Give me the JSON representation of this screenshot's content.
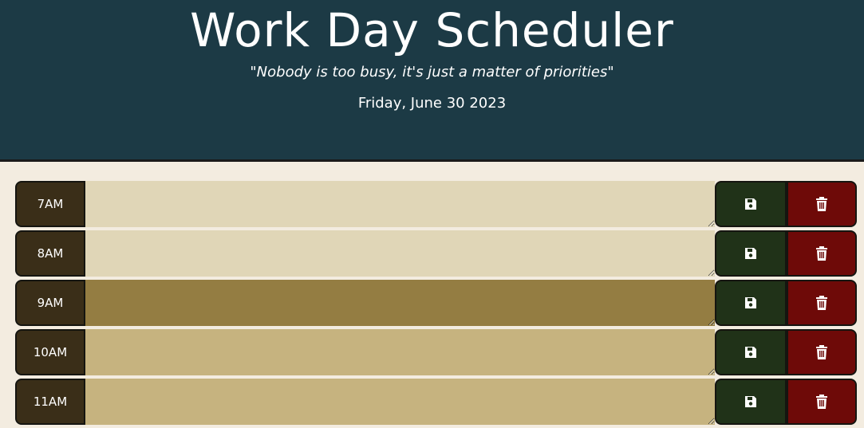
{
  "header": {
    "title": "Work Day Scheduler",
    "quote": "\"Nobody is too busy, it's just a matter of priorities\"",
    "date": "Friday, June 30 2023"
  },
  "colors": {
    "header_bg": "#1c3a45",
    "past": "#e0d6b7",
    "present": "#947d42",
    "future": "#c6b37f",
    "save": "#203218",
    "delete": "#6e0a08"
  },
  "rows": [
    {
      "hour": "7AM",
      "state": "past",
      "task": ""
    },
    {
      "hour": "8AM",
      "state": "past",
      "task": ""
    },
    {
      "hour": "9AM",
      "state": "present",
      "task": ""
    },
    {
      "hour": "10AM",
      "state": "future",
      "task": ""
    },
    {
      "hour": "11AM",
      "state": "future",
      "task": ""
    }
  ],
  "icons": {
    "save": "floppy-disk-icon",
    "delete": "trash-icon"
  }
}
